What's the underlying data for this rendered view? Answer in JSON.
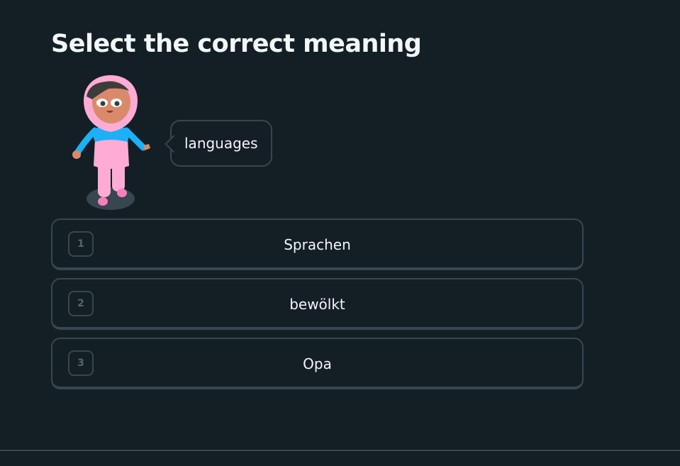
{
  "prompt": {
    "title": "Select the correct meaning"
  },
  "speech_bubble": {
    "text": "languages"
  },
  "character": {
    "icon": "character-girl-hijab-icon"
  },
  "options": [
    {
      "number": "1",
      "label": "Sprachen"
    },
    {
      "number": "2",
      "label": "bewölkt"
    },
    {
      "number": "3",
      "label": "Opa"
    }
  ],
  "colors": {
    "background": "#131f24",
    "border": "#37464f",
    "text": "#f1f7fb",
    "muted": "#52656d",
    "hijab": "#ffabd5",
    "shirt": "#1cb0f6",
    "skin": "#d98a6a"
  }
}
